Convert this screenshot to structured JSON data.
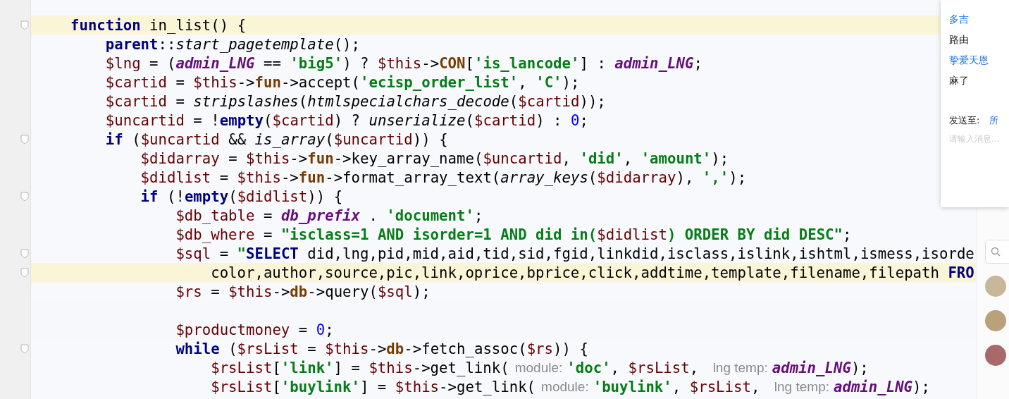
{
  "editor": {
    "lines": [
      {
        "fold": true,
        "highlighted": true,
        "tokens": [
          {
            "kind": "kw",
            "text": "function"
          },
          {
            "kind": "p",
            "text": " in_list() {"
          }
        ],
        "children": [
          {
            "tokens": [
              {
                "kind": "kw",
                "text": "parent"
              },
              {
                "kind": "p",
                "text": "::"
              },
              {
                "kind": "fn",
                "text": "start_pagetemplate"
              },
              {
                "kind": "p",
                "text": "();"
              }
            ]
          },
          {
            "tokens": [
              {
                "kind": "var",
                "text": "$lng"
              },
              {
                "kind": "p",
                "text": " = ("
              },
              {
                "kind": "const",
                "text": "admin_LNG"
              },
              {
                "kind": "p",
                "text": " == "
              },
              {
                "kind": "str",
                "text": "'big5'"
              },
              {
                "kind": "p",
                "text": ") ? "
              },
              {
                "kind": "var",
                "text": "$this"
              },
              {
                "kind": "p",
                "text": "->"
              },
              {
                "kind": "prop",
                "text": "CON"
              },
              {
                "kind": "p",
                "text": "["
              },
              {
                "kind": "str",
                "text": "'is_lancode'"
              },
              {
                "kind": "p",
                "text": "] : "
              },
              {
                "kind": "const",
                "text": "admin_LNG"
              },
              {
                "kind": "p",
                "text": ";"
              }
            ]
          },
          {
            "tokens": [
              {
                "kind": "var",
                "text": "$cartid"
              },
              {
                "kind": "p",
                "text": " = "
              },
              {
                "kind": "var",
                "text": "$this"
              },
              {
                "kind": "p",
                "text": "->"
              },
              {
                "kind": "prop",
                "text": "fun"
              },
              {
                "kind": "p",
                "text": "->accept("
              },
              {
                "kind": "str",
                "text": "'ecisp_order_list'"
              },
              {
                "kind": "p",
                "text": ", "
              },
              {
                "kind": "str",
                "text": "'C'"
              },
              {
                "kind": "p",
                "text": ");"
              }
            ]
          },
          {
            "tokens": [
              {
                "kind": "var",
                "text": "$cartid"
              },
              {
                "kind": "p",
                "text": " = "
              },
              {
                "kind": "fn",
                "text": "stripslashes"
              },
              {
                "kind": "p",
                "text": "("
              },
              {
                "kind": "fn",
                "text": "htmlspecialchars_decode"
              },
              {
                "kind": "p",
                "text": "("
              },
              {
                "kind": "var",
                "text": "$cartid"
              },
              {
                "kind": "p",
                "text": "));"
              }
            ]
          },
          {
            "tokens": [
              {
                "kind": "var",
                "text": "$uncartid"
              },
              {
                "kind": "p",
                "text": " = !"
              },
              {
                "kind": "kw",
                "text": "empty"
              },
              {
                "kind": "p",
                "text": "("
              },
              {
                "kind": "var",
                "text": "$cartid"
              },
              {
                "kind": "p",
                "text": ") ? "
              },
              {
                "kind": "fn",
                "text": "unserialize"
              },
              {
                "kind": "p",
                "text": "("
              },
              {
                "kind": "var",
                "text": "$cartid"
              },
              {
                "kind": "p",
                "text": ") : "
              },
              {
                "kind": "num",
                "text": "0"
              },
              {
                "kind": "p",
                "text": ";"
              }
            ]
          },
          {
            "fold": true,
            "tokens": [
              {
                "kind": "kw",
                "text": "if"
              },
              {
                "kind": "p",
                "text": " ("
              },
              {
                "kind": "var",
                "text": "$uncartid"
              },
              {
                "kind": "p",
                "text": " && "
              },
              {
                "kind": "fn",
                "text": "is_array"
              },
              {
                "kind": "p",
                "text": "("
              },
              {
                "kind": "var",
                "text": "$uncartid"
              },
              {
                "kind": "p",
                "text": ")) {"
              }
            ],
            "children": [
              {
                "tokens": [
                  {
                    "kind": "var",
                    "text": "$didarray"
                  },
                  {
                    "kind": "p",
                    "text": " = "
                  },
                  {
                    "kind": "var",
                    "text": "$this"
                  },
                  {
                    "kind": "p",
                    "text": "->"
                  },
                  {
                    "kind": "prop",
                    "text": "fun"
                  },
                  {
                    "kind": "p",
                    "text": "->key_array_name("
                  },
                  {
                    "kind": "var",
                    "text": "$uncartid"
                  },
                  {
                    "kind": "p",
                    "text": ", "
                  },
                  {
                    "kind": "str",
                    "text": "'did'"
                  },
                  {
                    "kind": "p",
                    "text": ", "
                  },
                  {
                    "kind": "str",
                    "text": "'amount'"
                  },
                  {
                    "kind": "p",
                    "text": ");"
                  }
                ]
              },
              {
                "tokens": [
                  {
                    "kind": "var",
                    "text": "$didlist"
                  },
                  {
                    "kind": "p",
                    "text": " = "
                  },
                  {
                    "kind": "var",
                    "text": "$this"
                  },
                  {
                    "kind": "p",
                    "text": "->"
                  },
                  {
                    "kind": "prop",
                    "text": "fun"
                  },
                  {
                    "kind": "p",
                    "text": "->format_array_text("
                  },
                  {
                    "kind": "fn",
                    "text": "array_keys"
                  },
                  {
                    "kind": "p",
                    "text": "("
                  },
                  {
                    "kind": "var",
                    "text": "$didarray"
                  },
                  {
                    "kind": "p",
                    "text": "), "
                  },
                  {
                    "kind": "str",
                    "text": "','"
                  },
                  {
                    "kind": "p",
                    "text": ");"
                  }
                ]
              },
              {
                "fold": true,
                "tokens": [
                  {
                    "kind": "kw",
                    "text": "if"
                  },
                  {
                    "kind": "p",
                    "text": " (!"
                  },
                  {
                    "kind": "kw",
                    "text": "empty"
                  },
                  {
                    "kind": "p",
                    "text": "("
                  },
                  {
                    "kind": "var",
                    "text": "$didlist"
                  },
                  {
                    "kind": "p",
                    "text": ")) {"
                  }
                ],
                "children": [
                  {
                    "tokens": [
                      {
                        "kind": "var",
                        "text": "$db_table"
                      },
                      {
                        "kind": "p",
                        "text": " = "
                      },
                      {
                        "kind": "const",
                        "text": "db_prefix"
                      },
                      {
                        "kind": "p",
                        "text": " . "
                      },
                      {
                        "kind": "str",
                        "text": "'document'"
                      },
                      {
                        "kind": "p",
                        "text": ";"
                      }
                    ]
                  },
                  {
                    "tokens": [
                      {
                        "kind": "var",
                        "text": "$db_where"
                      },
                      {
                        "kind": "p",
                        "text": " = "
                      },
                      {
                        "kind": "str",
                        "text": "\"isclass=1 AND isorder=1 AND did in("
                      },
                      {
                        "kind": "var",
                        "text": "$didlist"
                      },
                      {
                        "kind": "str",
                        "text": ") ORDER BY did DESC\""
                      },
                      {
                        "kind": "p",
                        "text": ";"
                      }
                    ]
                  },
                  {
                    "fold": true,
                    "tokens": [
                      {
                        "kind": "var",
                        "text": "$sql"
                      },
                      {
                        "kind": "p",
                        "text": " = "
                      },
                      {
                        "kind": "str",
                        "text": "\""
                      },
                      {
                        "kind": "kw",
                        "text": "SELECT"
                      },
                      {
                        "kind": "sql",
                        "text": " did,lng,pid,mid,aid,tid,sid,fgid,linkdid,isclass,islink,ishtml,ismess,isorde"
                      }
                    ],
                    "children": [
                      {
                        "fold": true,
                        "highlighted": true,
                        "tokens": [
                          {
                            "kind": "sql",
                            "text": "color,author,source,pic,link,oprice,bprice,click,addtime,template,filename,filepath "
                          },
                          {
                            "kind": "kw",
                            "text": "FRO"
                          }
                        ]
                      }
                    ]
                  },
                  {
                    "tokens": [
                      {
                        "kind": "var",
                        "text": "$rs"
                      },
                      {
                        "kind": "p",
                        "text": " = "
                      },
                      {
                        "kind": "var",
                        "text": "$this"
                      },
                      {
                        "kind": "p",
                        "text": "->"
                      },
                      {
                        "kind": "prop",
                        "text": "db"
                      },
                      {
                        "kind": "p",
                        "text": "->query("
                      },
                      {
                        "kind": "var",
                        "text": "$sql"
                      },
                      {
                        "kind": "p",
                        "text": ");"
                      }
                    ]
                  },
                  {
                    "blank_line_before": true,
                    "tokens": [
                      {
                        "kind": "var",
                        "text": "$productmoney"
                      },
                      {
                        "kind": "p",
                        "text": " = "
                      },
                      {
                        "kind": "num",
                        "text": "0"
                      },
                      {
                        "kind": "p",
                        "text": ";"
                      }
                    ]
                  },
                  {
                    "fold": true,
                    "tokens": [
                      {
                        "kind": "kw",
                        "text": "while"
                      },
                      {
                        "kind": "p",
                        "text": " ("
                      },
                      {
                        "kind": "var",
                        "text": "$rsList"
                      },
                      {
                        "kind": "p",
                        "text": " = "
                      },
                      {
                        "kind": "var",
                        "text": "$this"
                      },
                      {
                        "kind": "p",
                        "text": "->"
                      },
                      {
                        "kind": "prop",
                        "text": "db"
                      },
                      {
                        "kind": "p",
                        "text": "->fetch_assoc("
                      },
                      {
                        "kind": "var",
                        "text": "$rs"
                      },
                      {
                        "kind": "p",
                        "text": ")) {"
                      }
                    ],
                    "children": [
                      {
                        "tokens": [
                          {
                            "kind": "var",
                            "text": "$rsList"
                          },
                          {
                            "kind": "p",
                            "text": "["
                          },
                          {
                            "kind": "str",
                            "text": "'link'"
                          },
                          {
                            "kind": "p",
                            "text": "] = "
                          },
                          {
                            "kind": "var",
                            "text": "$this"
                          },
                          {
                            "kind": "p",
                            "text": "->get_link("
                          },
                          {
                            "kind": "hint",
                            "text": "module:"
                          },
                          {
                            "kind": "str",
                            "text": "'doc'"
                          },
                          {
                            "kind": "p",
                            "text": ", "
                          },
                          {
                            "kind": "var",
                            "text": "$rsList"
                          },
                          {
                            "kind": "p",
                            "text": ", "
                          },
                          {
                            "kind": "hint",
                            "text": "lng temp:"
                          },
                          {
                            "kind": "const",
                            "text": "admin_LNG"
                          },
                          {
                            "kind": "p",
                            "text": ");"
                          }
                        ]
                      },
                      {
                        "tokens": [
                          {
                            "kind": "var",
                            "text": "$rsList"
                          },
                          {
                            "kind": "p",
                            "text": "["
                          },
                          {
                            "kind": "str",
                            "text": "'buylink'"
                          },
                          {
                            "kind": "p",
                            "text": "] = "
                          },
                          {
                            "kind": "var",
                            "text": "$this"
                          },
                          {
                            "kind": "p",
                            "text": "->get_link("
                          },
                          {
                            "kind": "hint",
                            "text": "module:"
                          },
                          {
                            "kind": "str",
                            "text": "'buylink'"
                          },
                          {
                            "kind": "p",
                            "text": ", "
                          },
                          {
                            "kind": "var",
                            "text": "$rsList"
                          },
                          {
                            "kind": "p",
                            "text": ", "
                          },
                          {
                            "kind": "hint",
                            "text": "lng temp:"
                          },
                          {
                            "kind": "const",
                            "text": "admin_LNG"
                          },
                          {
                            "kind": "p",
                            "text": ");"
                          }
                        ]
                      }
                    ]
                  }
                ]
              }
            ]
          }
        ]
      }
    ]
  },
  "chat_panel": {
    "messages": [
      {
        "kind": "name",
        "text": "多吉"
      },
      {
        "kind": "message",
        "text": "路由"
      },
      {
        "kind": "name",
        "text": "挚爱天恩"
      },
      {
        "kind": "message",
        "text": "麻了"
      }
    ],
    "send_to_label": "发送至:",
    "send_to_value": "所",
    "input": {
      "placeholder": "请输入消息..."
    }
  }
}
